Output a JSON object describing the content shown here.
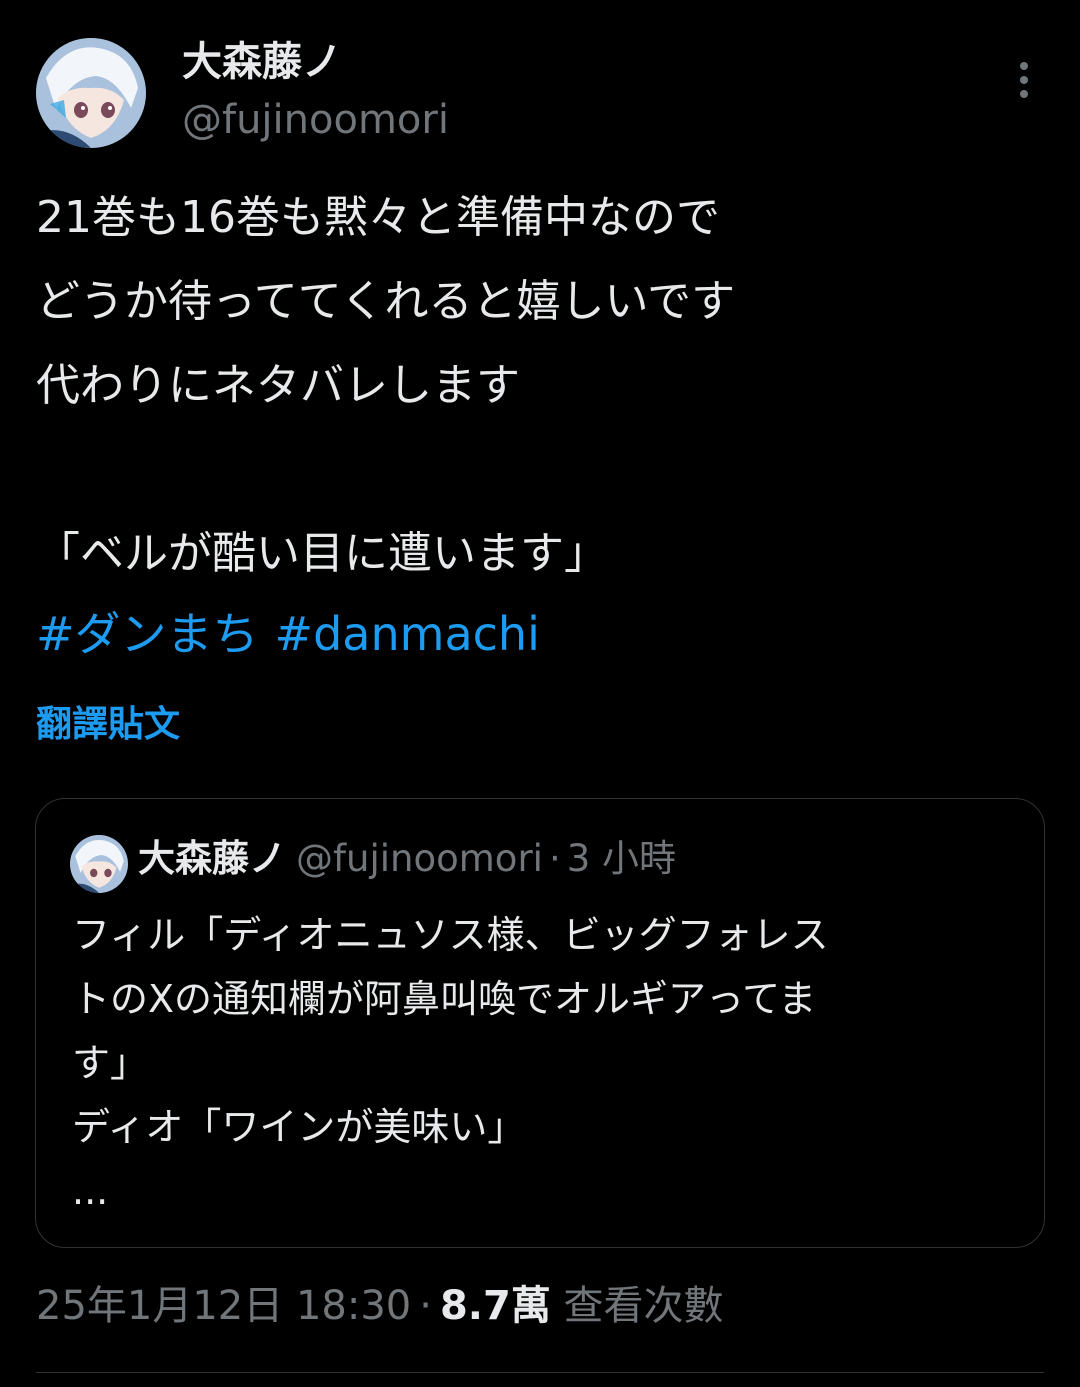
{
  "author": {
    "display_name": "大森藤ノ",
    "handle": "@fujinoomori"
  },
  "post": {
    "lines": [
      "21巻も16巻も黙々と準備中なので",
      "どうか待っててくれると嬉しいです",
      "代わりにネタバレします",
      "",
      "「ベルが酷い目に遭います」"
    ],
    "hashtags": [
      "#ダンまち",
      "#danmachi"
    ],
    "translate_label": "翻譯貼文"
  },
  "quote": {
    "display_name": "大森藤ノ",
    "handle": "@fujinoomori",
    "dot": "·",
    "time": "3 小時",
    "lines": [
      "フィル「ディオニュソス様、ビッグフォレス",
      "トのXの通知欄が阿鼻叫喚でオルギアってま",
      "す」",
      "ディオ「ワインが美味い」",
      "..."
    ]
  },
  "meta": {
    "timestamp": "25年1月12日 18:30",
    "dot": "·",
    "views_count": "8.7萬",
    "views_label": "查看次數"
  },
  "icons": {
    "more": "more-vertical-icon"
  },
  "colors": {
    "background": "#000000",
    "text": "#e7e9ea",
    "secondary": "#71767b",
    "accent": "#1d9bf0",
    "border": "#2f3336"
  }
}
